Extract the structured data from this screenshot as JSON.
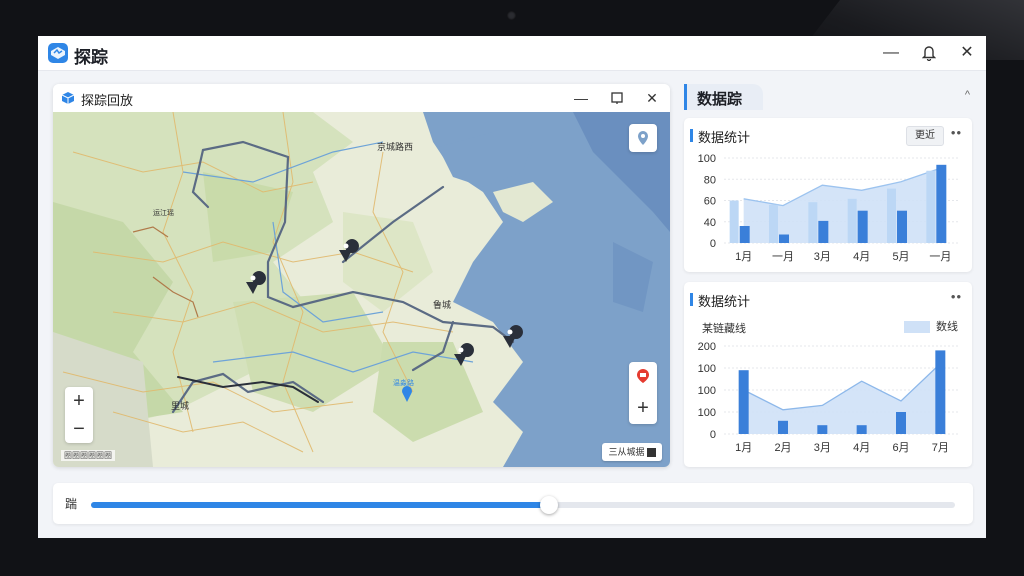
{
  "app": {
    "title": "探踪",
    "minimize": "—",
    "close": "✕"
  },
  "map_window": {
    "title": "探踪回放",
    "minimize": "—",
    "close": "✕",
    "city_labels": [
      "京城路西",
      "鲁城",
      "温淼路",
      "里城",
      "运江瑶"
    ],
    "scale_text": "圈圈圈圈圈圈",
    "legend_text": "三从城据",
    "zoom_in": "+",
    "zoom_out": "−",
    "add": "+"
  },
  "right_panel": {
    "tab_label": "数据踪",
    "collapse": "^",
    "card1": {
      "title": "数据统计",
      "filter": "更近",
      "more": "••"
    },
    "card2": {
      "title": "数据统计",
      "more": "••",
      "subtitle": "某链藏线",
      "legend": "数线"
    }
  },
  "timeline": {
    "label": "踹",
    "progress": 0.53
  },
  "chart_data": [
    {
      "type": "bar",
      "categories": [
        "1月",
        "一月",
        "3月",
        "4月",
        "5月",
        "一月"
      ],
      "series": [
        {
          "values": [
            50,
            45,
            48,
            52,
            64,
            85
          ]
        },
        {
          "values": [
            20,
            10,
            26,
            38,
            38,
            92
          ]
        }
      ],
      "area_values": [
        52,
        44,
        68,
        62,
        72,
        88
      ],
      "yticks": [
        100,
        80,
        60,
        40,
        0
      ],
      "ylim": [
        0,
        100
      ]
    },
    {
      "type": "bar",
      "categories": [
        "1月",
        "2月",
        "3月",
        "4月",
        "6月",
        "7月"
      ],
      "values": [
        145,
        30,
        20,
        20,
        50,
        190
      ],
      "area_values": [
        100,
        55,
        65,
        120,
        75,
        160
      ],
      "yticks": [
        "200",
        "100",
        "100",
        "100",
        "0"
      ],
      "ylim": [
        0,
        200
      ]
    }
  ]
}
